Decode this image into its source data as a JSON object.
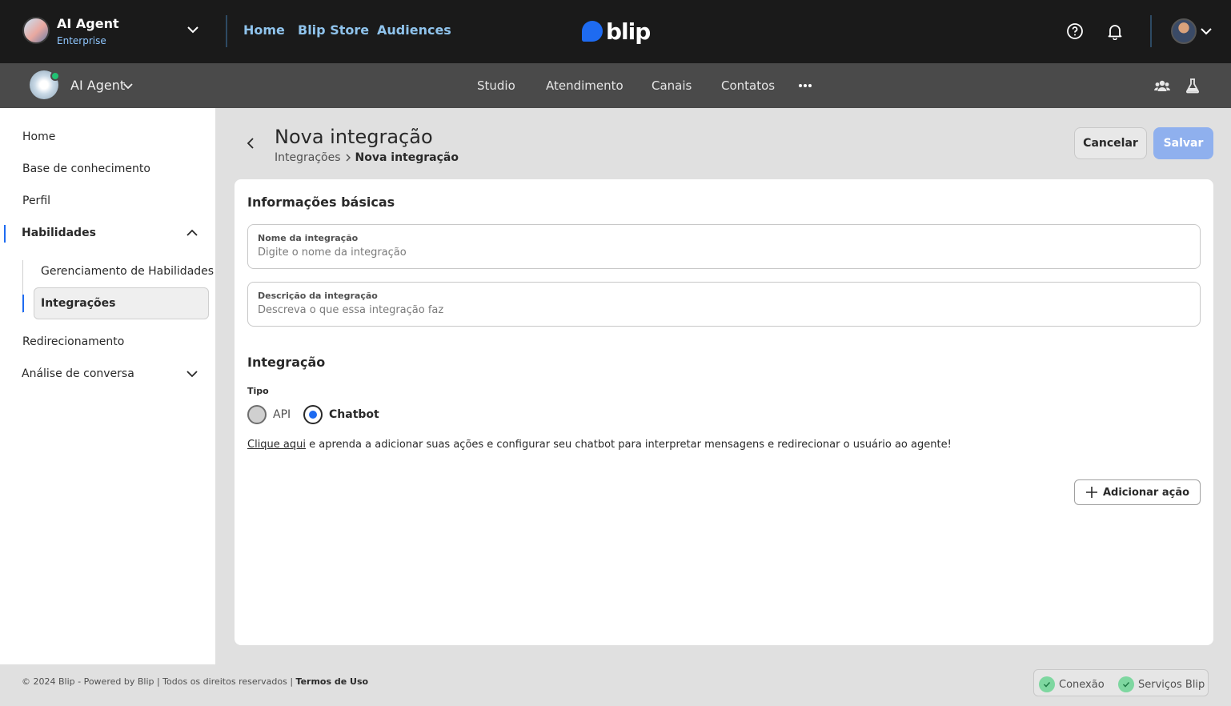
{
  "topbar": {
    "org_title": "AI Agent",
    "org_subtitle": "Enterprise",
    "nav": [
      "Home",
      "Blip Store",
      "Audiences"
    ],
    "logo_text": "blip",
    "icons": [
      "help-icon",
      "bell-icon",
      "user-avatar",
      "chevron-down-icon"
    ]
  },
  "subbar": {
    "bot_name": "AI Agent",
    "nav": [
      "Studio",
      "Atendimento",
      "Canais",
      "Contatos"
    ],
    "more_icon": "more-horizontal-icon",
    "right_icons": [
      "team-icon",
      "lab-flask-icon"
    ]
  },
  "sidebar": {
    "items": [
      {
        "label": "Home"
      },
      {
        "label": "Base de conhecimento"
      },
      {
        "label": "Perfil"
      },
      {
        "label": "Habilidades",
        "expanded": true,
        "children": [
          {
            "label": "Gerenciamento de Habilidades"
          },
          {
            "label": "Integrações",
            "selected": true
          }
        ]
      },
      {
        "label": "Redirecionamento"
      },
      {
        "label": "Análise de conversa",
        "expanded": false
      }
    ]
  },
  "header": {
    "title": "Nova integração",
    "breadcrumb": [
      "Integrações",
      "Nova integração"
    ],
    "cancel_label": "Cancelar",
    "save_label": "Salvar"
  },
  "form": {
    "basic_title": "Informações básicas",
    "name_label": "Nome da integração",
    "name_placeholder": "Digite o nome da integração",
    "desc_label": "Descrição da integração",
    "desc_placeholder": "Descreva o que essa integração faz",
    "integration_title": "Integração",
    "type_label": "Tipo",
    "type_options": [
      "API",
      "Chatbot"
    ],
    "type_selected": "Chatbot",
    "help_link": "Clique aqui",
    "help_text": " e aprenda a adicionar suas ações e configurar seu chatbot para interpretar mensagens e redirecionar o usuário ao agente!",
    "add_action_label": "Adicionar ação"
  },
  "footer": {
    "copyright": "© 2024 Blip - Powered by Blip | Todos os direitos reservados | ",
    "terms": "Termos de Uso",
    "status": [
      "Conexão",
      "Serviços Blip"
    ]
  },
  "colors": {
    "accent": "#1e6bf1",
    "topbar_bg": "#1a1a1a",
    "subbar_bg": "#4a4a4a",
    "save_disabled": "#8fb0ee",
    "status_ok": "#7ed7a0"
  }
}
